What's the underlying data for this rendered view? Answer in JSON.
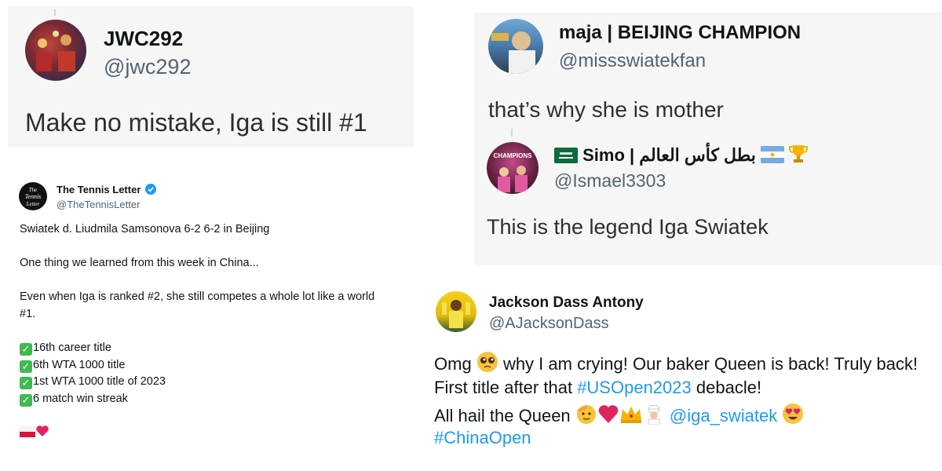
{
  "tweet_jwc": {
    "name": "JWC292",
    "handle": "@jwc292",
    "text": "Make no mistake, Iga is still #1"
  },
  "tweet_maja": {
    "name": "maja | BEIJING CHAMPION",
    "handle": "@missswiatekfan",
    "text": "that’s why she is mother"
  },
  "tweet_simo": {
    "name": "Simo | بطل كأس العالم",
    "handle": "@Ismael3303",
    "text": "This is the legend Iga Swiatek",
    "avatar_text": "CHAMPIONS"
  },
  "tweet_ttl": {
    "name": "The Tennis Letter",
    "handle": "@TheTennisLetter",
    "logo_text": "The Tennis Letter",
    "line1": "Swiatek d. Liudmila Samsonova 6-2 6-2 in Beijing",
    "line2": "One thing we learned from this week in China...",
    "line3a": "Even when Iga is ranked #2, she still competes a whole lot like a world",
    "line3b": "#1.",
    "items": [
      "16th career title",
      "6th WTA 1000 title",
      "1st WTA 1000 title of 2023",
      "6 match win streak"
    ],
    "check_glyph": "✓"
  },
  "tweet_jda": {
    "name": "Jackson Dass Antony",
    "handle": "@AJacksonDass",
    "l1_a": "Omg",
    "l1_b": "why I am crying! Our baker Queen is back! Truly back!",
    "l2_a": "First title after that",
    "l2_hashtag": "#USOpen2023",
    "l2_b": "debacle!",
    "l3_a": "All hail the Queen",
    "l3_mention": "@iga_swiatek",
    "l4_hashtag": "#ChinaOpen"
  },
  "colors": {
    "accent": "#1d9bf0",
    "handle": "#536471",
    "panel_bg": "#f6f6f6",
    "text": "#0f1419"
  },
  "icons": [
    "verified-badge-icon",
    "check-mark-icon",
    "poland-flag-icon",
    "red-heart-icon",
    "pleading-face-icon",
    "saluting-face-icon",
    "crown-icon",
    "baker-icon",
    "heart-eyes-icon",
    "saudi-flag-icon",
    "argentina-flag-icon",
    "trophy-icon"
  ]
}
